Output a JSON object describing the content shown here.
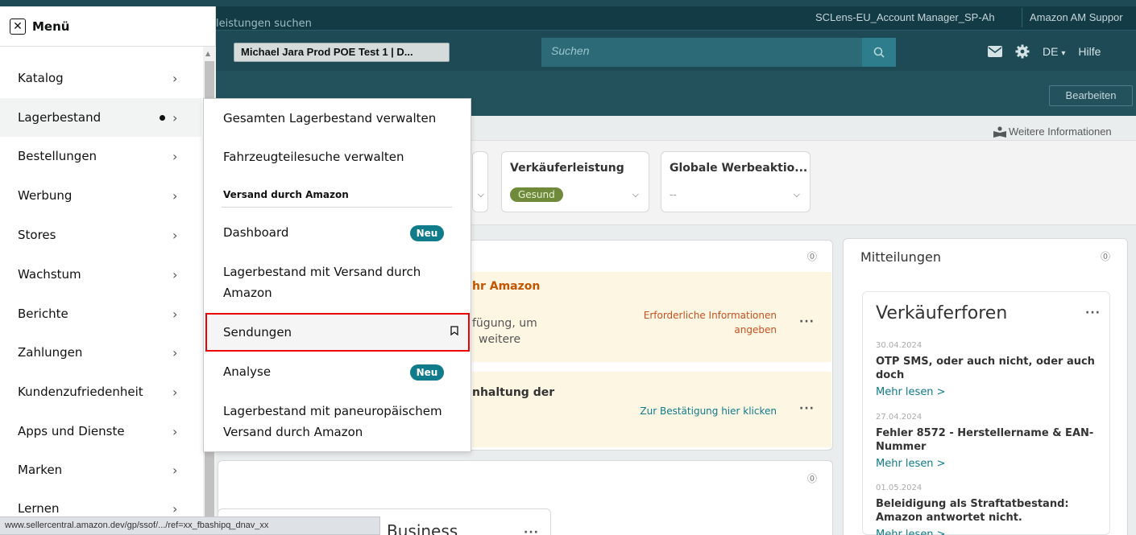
{
  "header": {
    "accounts": [
      "SCLens-EU_Account Manager_SP-Ah",
      "Amazon AM Suppor"
    ],
    "store_selector": "Michael Jara Prod POE Test 1 | D...",
    "search_placeholder": "Suchen",
    "language": "DE",
    "help": "Hilfe",
    "subbar_text": "leistungen suchen",
    "edit_button": "Bearbeiten",
    "more_info": "Weitere Informationen"
  },
  "metrics": [
    {
      "title": "Verkäuferleistung",
      "badge": "Gesund"
    },
    {
      "title": "Globale Werbeaktio...",
      "value": "--"
    }
  ],
  "alerts": [
    {
      "title": "hr Amazon",
      "text1": "fügung, um",
      "text2": "weitere",
      "link1": "Erforderliche Informationen",
      "link2": "angeben",
      "link_color": "#c7511f"
    },
    {
      "title": "nhaltung der",
      "link1": "Zur Bestätigung hier klicken",
      "link_color": "#0f7b8b"
    }
  ],
  "notifications": {
    "title": "Mitteilungen",
    "forum_title": "Verkäuferforen",
    "posts": [
      {
        "date": "30.04.2024",
        "title": "OTP SMS, oder auch nicht, oder auch doch",
        "more": "Mehr lesen >"
      },
      {
        "date": "27.04.2024",
        "title": "Fehler 8572 - Herstellername & EAN-Nummer",
        "more": "Mehr lesen >"
      },
      {
        "date": "01.05.2024",
        "title": "Beleidigung als Straftatbestand: Amazon antwortet nicht.",
        "more": "Mehr lesen >"
      }
    ]
  },
  "business_card_title": "Business",
  "menu": {
    "title": "Menü",
    "items": [
      {
        "label": "Katalog"
      },
      {
        "label": "Lagerbestand"
      },
      {
        "label": "Bestellungen"
      },
      {
        "label": "Werbung"
      },
      {
        "label": "Stores"
      },
      {
        "label": "Wachstum"
      },
      {
        "label": "Berichte"
      },
      {
        "label": "Zahlungen"
      },
      {
        "label": "Kundenzufriedenheit"
      },
      {
        "label": "Apps und Dienste"
      },
      {
        "label": "Marken"
      },
      {
        "label": "Lernen"
      }
    ]
  },
  "flyout": {
    "items": {
      "manage_inventory": "Gesamten Lagerbestand verwalten",
      "vehicle_search": "Fahrzeugteilesuche verwalten",
      "section": "Versand durch Amazon",
      "dashboard": "Dashboard",
      "fba_line1": "Lagerbestand mit Versand durch",
      "fba_line2": "Amazon",
      "shipments": "Sendungen",
      "analysis": "Analyse",
      "paneu_line1": "Lagerbestand mit paneuropäischem",
      "paneu_line2": "Versand durch Amazon"
    },
    "new_badge": "Neu"
  },
  "status_url": "www.sellercentral.amazon.dev/gp/ssof/.../ref=xx_fbashipq_dnav_xx"
}
